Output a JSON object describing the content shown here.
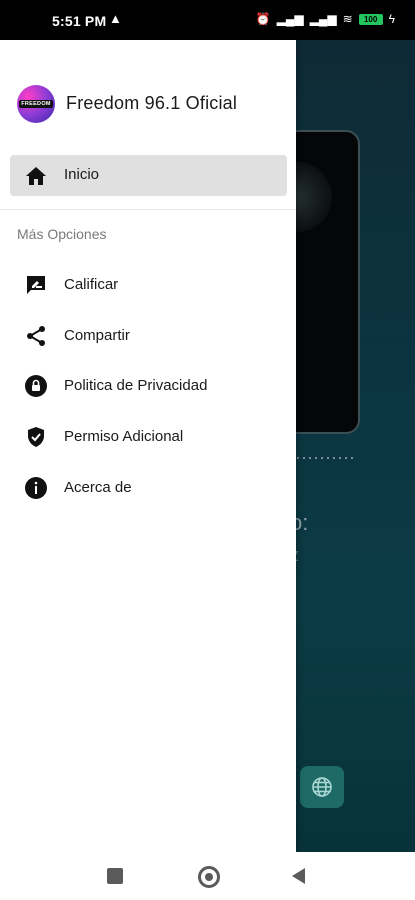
{
  "status": {
    "time": "5:51 PM",
    "battery": "100"
  },
  "drawer": {
    "logo_text": "FREEDOM",
    "title": "Freedom 96.1 Oficial",
    "active_item": {
      "label": "Inicio",
      "icon": "home-icon"
    },
    "section_label": "Más Opciones",
    "items": [
      {
        "label": "Calificar",
        "icon": "rate-review-icon"
      },
      {
        "label": "Compartir",
        "icon": "share-icon"
      },
      {
        "label": "Politica de Privacidad",
        "icon": "lock-icon"
      },
      {
        "label": "Permiso Adicional",
        "icon": "shield-check-icon"
      },
      {
        "label": "Acerca de",
        "icon": "info-icon"
      }
    ]
  },
  "background": {
    "text_line1": "o:",
    "text_line2": "z"
  },
  "colors": {
    "drawer_bg": "#ffffff",
    "active_bg": "#e0e0e0",
    "text": "#1b1b1b",
    "section_text": "#7a7a7a"
  }
}
